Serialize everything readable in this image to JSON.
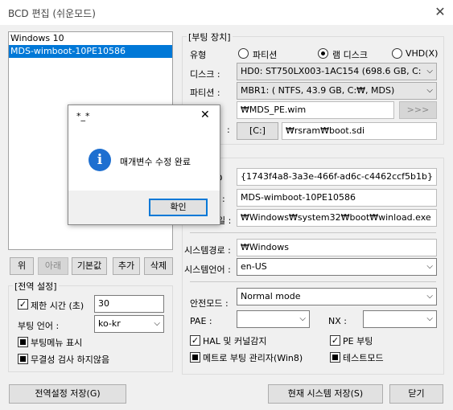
{
  "window": {
    "title": "BCD 편집 (쉬운모드)",
    "close": "✕"
  },
  "entries": [
    {
      "label": "Windows 10",
      "selected": false
    },
    {
      "label": "MDS-wimboot-10PE10586",
      "selected": true
    }
  ],
  "list_buttons": {
    "up": "위",
    "down": "아래",
    "default": "기본값",
    "add": "추가",
    "delete": "삭제"
  },
  "global": {
    "title": "[전역 설정]",
    "timeout_label": "제한 시간 (초)",
    "timeout_value": "30",
    "lang_label": "부팅 언어 :",
    "lang_value": "ko-kr",
    "menu_label": "부팅메뉴 표시",
    "integrity_label": "무결성 검사 하지않음"
  },
  "device": {
    "title": "[부팅 장치]",
    "type_label": "유형",
    "type_partition": "파티션",
    "type_ramdisk": "램 디스크",
    "type_vhd": "VHD(X)",
    "disk_label": "디스크 :",
    "disk_value": "HD0: ST750LX003-1AC154 (698.6 GB, C: D: E:",
    "partition_label": "파티션 :",
    "partition_value": "MBR1: ( NTFS,  43.9 GB, C:₩, MDS)",
    "wim_path": "₩MDS_PE.wim",
    "browse": ">>>",
    "sdi_label": ":",
    "sdi_drive": "[C:]",
    "sdi_path": "₩rsram₩boot.sdi"
  },
  "os": {
    "label_partial_a": "D",
    "guid": "{1743f4a8-3a3e-466f-ad6c-c4462ccf5b1b}",
    "label_partial_b": ":",
    "name": "MDS-wimboot-10PE10586",
    "label_partial_c": "일 :",
    "loader": "₩Windows₩system32₩boot₩winload.exe",
    "sysroot_label": "시스템경로 :",
    "sysroot": "₩Windows",
    "syslang_label": "시스템언어 :",
    "syslang": "en-US",
    "safemode_label": "안전모드 :",
    "safemode": "Normal mode",
    "pae_label": "PAE :",
    "pae": "",
    "nx_label": "NX :",
    "nx": "",
    "hal_label": "HAL 및 커널감지",
    "pe_label": "PE 부팅",
    "metro_label": "메트로 부팅 관리자(Win8)",
    "test_label": "테스트모드"
  },
  "footer": {
    "save_global": "전역설정 저장(G)",
    "save_current": "현재 시스템 저장(S)",
    "close": "닫기"
  },
  "dialog": {
    "title": "*_*",
    "close": "✕",
    "icon": "i",
    "message": "매개변수 수정 완료",
    "ok": "확인"
  }
}
